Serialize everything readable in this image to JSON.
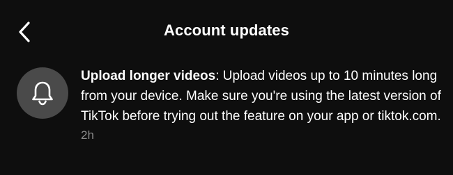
{
  "header": {
    "title": "Account updates",
    "back_icon": "chevron-left-icon"
  },
  "notification": {
    "icon": "bell-icon",
    "avatar_color": "#4a4a4a",
    "title": "Upload longer videos",
    "separator": ":",
    "message": " Upload videos up to 10 minutes long from your device. Make sure you're using the latest version of TikTok before trying out the feature on your app or tiktok.com.",
    "time": "2h"
  },
  "colors": {
    "background": "#0e0e0e",
    "text": "#ffffff",
    "muted": "#8a8a8a"
  }
}
